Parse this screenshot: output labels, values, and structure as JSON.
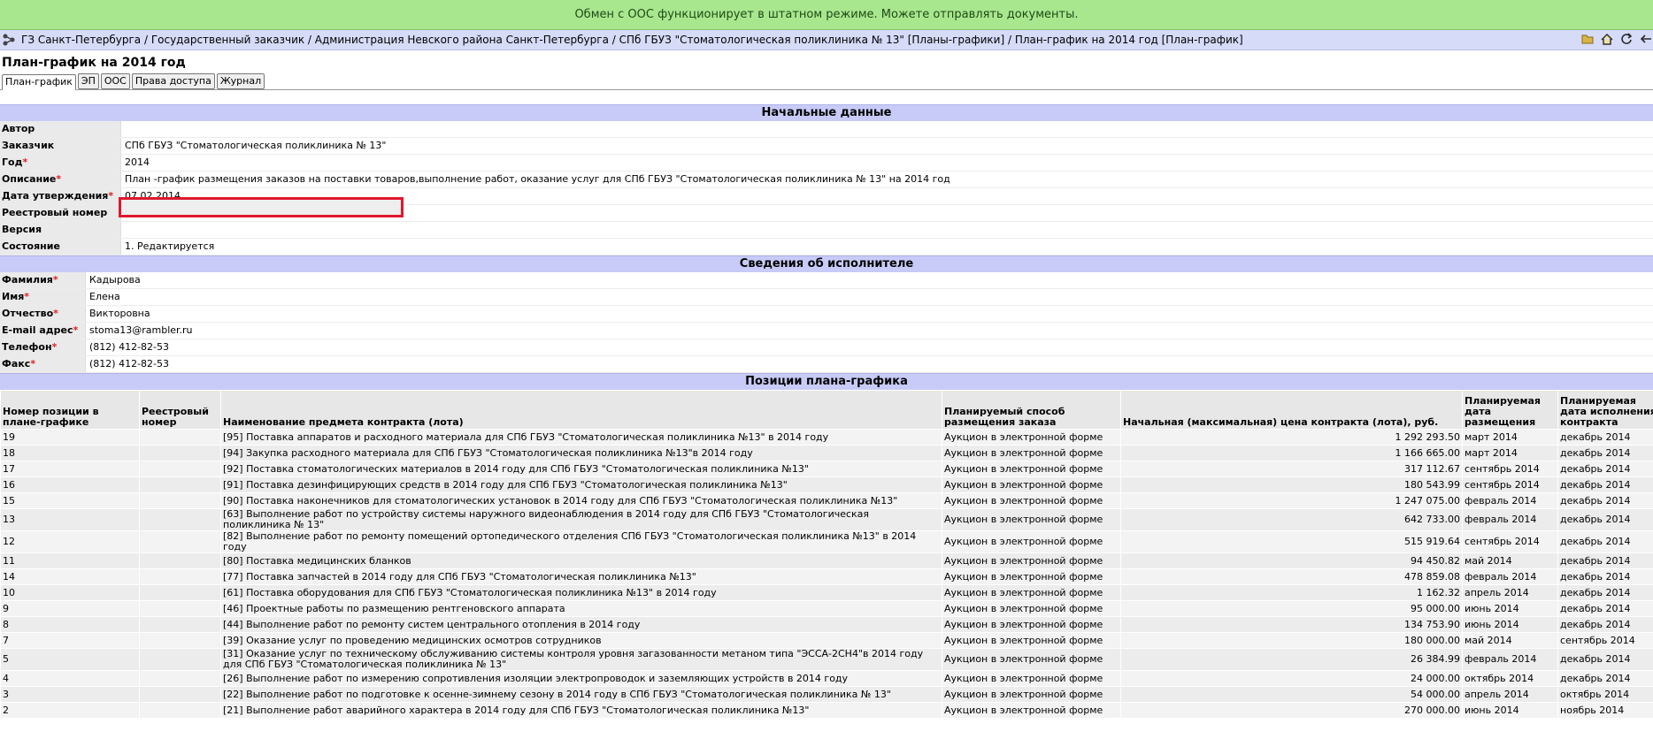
{
  "status": {
    "text": "Обмен с ООС функционирует в штатном режиме. Можете отправлять документы.",
    "color": "#a9e78f"
  },
  "breadcrumb": "ГЗ Санкт-Петербурга / Государственный заказчик / Администрация Невского района Санкт-Петербурга / СПб ГБУЗ \"Стоматологическая поликлиника № 13\" [Планы-графики] / План-график на 2014 год [План-график]",
  "page_title": "План-график на 2014 год",
  "tabs": [
    "План-график",
    "ЭП",
    "ООС",
    "Права доступа",
    "Журнал"
  ],
  "section_initial": {
    "title": "Начальные данные",
    "fields": [
      {
        "label": "Автор",
        "required": false,
        "value": ""
      },
      {
        "label": "Заказчик",
        "required": false,
        "value": "СПб ГБУЗ \"Стоматологическая поликлиника № 13\""
      },
      {
        "label": "Год",
        "required": true,
        "value": "2014"
      },
      {
        "label": "Описание",
        "required": true,
        "value": "План -график размещения заказов на поставки товаров,выполнение работ, оказание услуг для СПб ГБУЗ \"Стоматологическая поликлиника № 13\" на 2014 год"
      },
      {
        "label": "Дата утверждения",
        "required": true,
        "value": "07.02.2014"
      },
      {
        "label": "Реестровый номер",
        "required": false,
        "value": ""
      },
      {
        "label": "Версия",
        "required": false,
        "value": ""
      },
      {
        "label": "Состояние",
        "required": false,
        "value": "1. Редактируется"
      }
    ]
  },
  "section_executor": {
    "title": "Сведения об исполнителе",
    "fields": [
      {
        "label": "Фамилия",
        "required": true,
        "value": "Кадырова"
      },
      {
        "label": "Имя",
        "required": true,
        "value": "Елена"
      },
      {
        "label": "Отчество",
        "required": true,
        "value": "Викторовна"
      },
      {
        "label": "E-mail адрес",
        "required": true,
        "value": "stoma13@rambler.ru"
      },
      {
        "label": "Телефон",
        "required": true,
        "value": "(812) 412-82-53"
      },
      {
        "label": "Факс",
        "required": true,
        "value": "(812) 412-82-53"
      }
    ]
  },
  "section_positions": {
    "title": "Позиции плана-графика",
    "columns": [
      "Номер позиции в плане-графике",
      "Реестровый номер",
      "Наименование предмета контракта (лота)",
      "Планируемый способ размещения заказа",
      "Начальная (максимальная) цена контракта (лота), руб.",
      "Планируемая дата размещения",
      "Планируемая дата исполнения контракта"
    ],
    "rows": [
      [
        "19",
        "",
        "[95] Поставка аппаратов и расходного материала для СПб ГБУЗ \"Стоматологическая поликлиника №13\" в 2014 году",
        "Аукцион в электронной форме",
        "1 292 293.50",
        "март 2014",
        "декабрь 2014"
      ],
      [
        "18",
        "",
        "[94] Закупка расходного материала для СПб ГБУЗ \"Стоматологическая поликлиника №13\"в 2014 году",
        "Аукцион в электронной форме",
        "1 166 665.00",
        "март 2014",
        "декабрь 2014"
      ],
      [
        "17",
        "",
        "[92] Поставка стоматологических материалов в 2014 году для СПб ГБУЗ \"Стоматологическая поликлиника №13\"",
        "Аукцион в электронной форме",
        "317 112.67",
        "сентябрь 2014",
        "декабрь 2014"
      ],
      [
        "16",
        "",
        "[91] Поставка дезинфицирующих средств в 2014 году для СПб ГБУЗ \"Стоматологическая поликлиника №13\"",
        "Аукцион в электронной форме",
        "180 543.99",
        "сентябрь 2014",
        "декабрь 2014"
      ],
      [
        "15",
        "",
        "[90] Поставка наконечников для стоматологических установок в 2014 году для СПб ГБУЗ \"Стоматологическая поликлиника №13\"",
        "Аукцион в электронной форме",
        "1 247 075.00",
        "февраль 2014",
        "декабрь 2014"
      ],
      [
        "13",
        "",
        "[63] Выполнение работ по устройству системы наружного видеонаблюдения в 2014 году для СПб ГБУЗ \"Стоматологическая поликлиника № 13\"",
        "Аукцион в электронной форме",
        "642 733.00",
        "февраль 2014",
        "декабрь 2014"
      ],
      [
        "12",
        "",
        "[82] Выполнение работ по ремонту помещений ортопедического отделения СПб ГБУЗ \"Стоматологическая поликлиника №13\" в 2014 году",
        "Аукцион в электронной форме",
        "515 919.64",
        "сентябрь 2014",
        "декабрь 2014"
      ],
      [
        "11",
        "",
        "[80] Поставка медицинских бланков",
        "Аукцион в электронной форме",
        "94 450.82",
        "май 2014",
        "декабрь 2014"
      ],
      [
        "14",
        "",
        "[77] Поставка запчастей в 2014 году для СПб ГБУЗ \"Стоматологическая поликлиника №13\"",
        "Аукцион в электронной форме",
        "478 859.08",
        "февраль 2014",
        "декабрь 2014"
      ],
      [
        "10",
        "",
        "[61] Поставка оборудования для СПб ГБУЗ \"Стоматологическая поликлиника №13\" в 2014 году",
        "Аукцион в электронной форме",
        "1 162.32",
        "апрель 2014",
        "декабрь 2014"
      ],
      [
        "9",
        "",
        "[46] Проектные работы по размещению рентгеновского аппарата",
        "Аукцион в электронной форме",
        "95 000.00",
        "июнь 2014",
        "декабрь 2014"
      ],
      [
        "8",
        "",
        "[44] Выполнение работ по ремонту систем центрального отопления в 2014 году",
        "Аукцион в электронной форме",
        "134 753.90",
        "июнь 2014",
        "декабрь 2014"
      ],
      [
        "7",
        "",
        "[39] Оказание услуг по проведению медицинских осмотров сотрудников",
        "Аукцион в электронной форме",
        "180 000.00",
        "май 2014",
        "сентябрь 2014"
      ],
      [
        "5",
        "",
        "[31] Оказание услуг по техническому обслуживанию системы контроля уровня загазованности метаном типа \"ЭССА-2СН4\"в 2014 году для СПб ГБУЗ \"Стоматологическая поликлиника № 13\"",
        "Аукцион в электронной форме",
        "26 384.99",
        "февраль 2014",
        "декабрь 2014"
      ],
      [
        "4",
        "",
        "[26] Выполнение работ по измерению сопротивления изоляции электропроводок и заземляющих устройств в 2014 году",
        "Аукцион в электронной форме",
        "24 000.00",
        "октябрь 2014",
        "декабрь 2014"
      ],
      [
        "3",
        "",
        "[22] Выполнение работ по подготовке к осенне-зимнему сезону в 2014 году в СПб ГБУЗ \"Стоматологическая поликлиника № 13\"",
        "Аукцион в электронной форме",
        "54 000.00",
        "апрель 2014",
        "октябрь 2014"
      ],
      [
        "2",
        "",
        "[21] Выполнение работ аварийного характера в 2014 году для СПб ГБУЗ \"Стоматологическая поликлиника №13\"",
        "Аукцион в электронной форме",
        "270 000.00",
        "июнь 2014",
        "ноябрь 2014"
      ]
    ]
  },
  "icons": {
    "app": "app-tree-icon",
    "toolbar": [
      "folder-icon",
      "home-icon",
      "refresh-icon",
      "back-arrow-icon"
    ]
  },
  "highlight_color": "#e0182d"
}
